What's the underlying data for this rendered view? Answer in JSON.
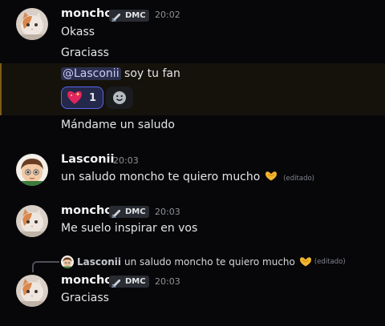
{
  "colors": {
    "background": "#070709",
    "mention_bg": "#2b2f4d",
    "highlight_bar": "#7c5b17",
    "reaction_border": "#5865f2"
  },
  "messages": [
    {
      "author": "moncho",
      "tag": "DMC",
      "time": "20:02",
      "lines": [
        "Okass",
        "Graciass"
      ]
    },
    {
      "mention": "@Lasconii",
      "text": " soy tu fan",
      "reaction": {
        "icon": "sparkling-heart-emoji",
        "count": "1"
      },
      "add_reaction_icon": "smiley-add-reaction-icon"
    },
    {
      "text": "Mándame un saludo"
    },
    {
      "author": "Lasconii",
      "time": "20:03",
      "text": "un saludo moncho te quiero mucho",
      "emoji": "heart-hands-emoji",
      "edited": "(editado)"
    },
    {
      "author": "moncho",
      "tag": "DMC",
      "time": "20:03",
      "text": "Me suelo inspirar en vos"
    },
    {
      "reply": {
        "author": "Lasconii",
        "text": "un saludo moncho te quiero mucho",
        "emoji": "heart-hands-emoji",
        "edited": "(editado)"
      },
      "author": "moncho",
      "tag": "DMC",
      "time": "20:03",
      "text": "Graciass"
    }
  ]
}
